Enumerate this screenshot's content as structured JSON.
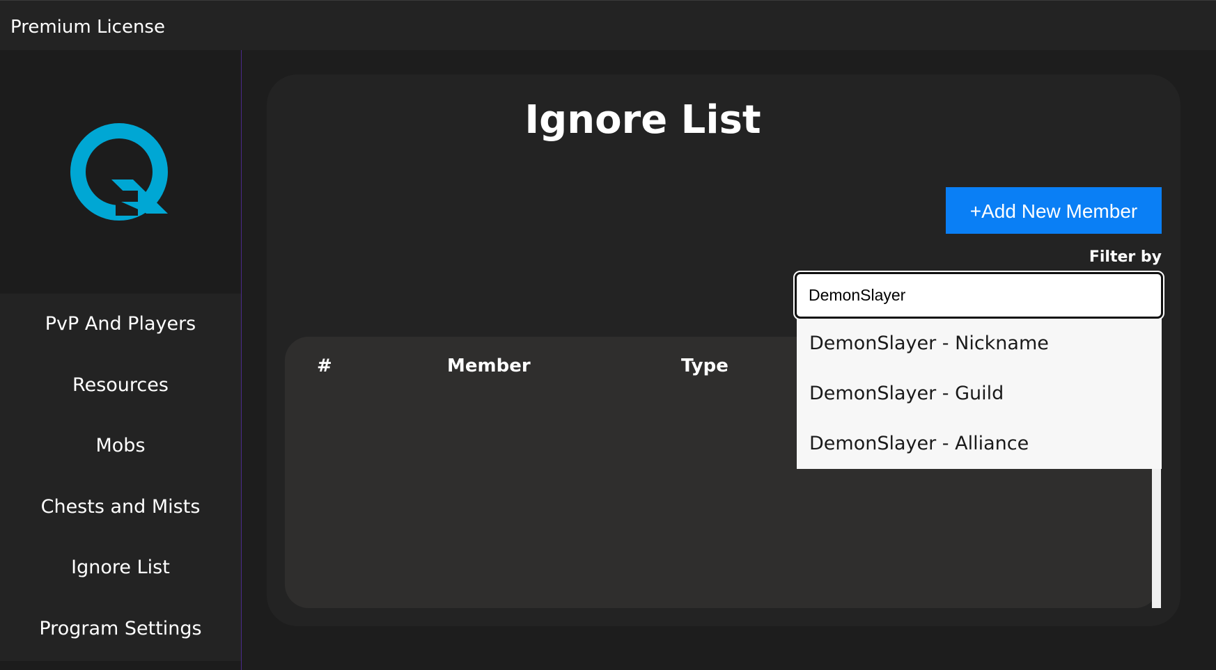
{
  "window": {
    "title": "Premium License"
  },
  "sidebar": {
    "logo": "q-logo-icon",
    "accent_color": "#00a7d4",
    "items": [
      {
        "label": "PvP And Players"
      },
      {
        "label": "Resources"
      },
      {
        "label": "Mobs"
      },
      {
        "label": "Chests and Mists"
      },
      {
        "label": "Ignore List"
      },
      {
        "label": "Program Settings"
      }
    ]
  },
  "main": {
    "title": "Ignore List",
    "add_button_label": "+Add New Member",
    "add_button_color": "#0a7ff5",
    "filter": {
      "label": "Filter by",
      "value": "DemonSlayer",
      "suggestions": [
        "DemonSlayer - Nickname",
        "DemonSlayer - Guild",
        "DemonSlayer - Alliance"
      ]
    },
    "table": {
      "columns": [
        "#",
        "Member",
        "Type"
      ],
      "rows": []
    }
  }
}
